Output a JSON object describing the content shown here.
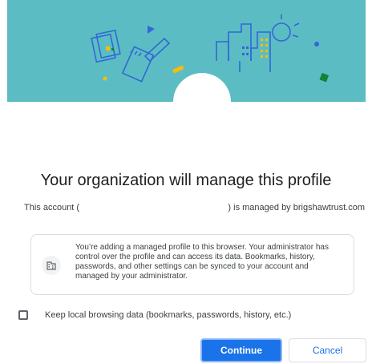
{
  "dialog": {
    "title": "Your organization will manage this profile",
    "account_prefix": "This account (",
    "account_suffix": ") is managed by brigshawtrust.com",
    "info_text": "You’re adding a managed profile to this browser. Your administrator has control over the profile and can access its data. Bookmarks, history, passwords, and other settings can be synced to your account and managed by your administrator.",
    "keep_local_label": "Keep local browsing data (bookmarks, passwords, history, etc.)",
    "keep_local_checked": false,
    "continue_label": "Continue",
    "cancel_label": "Cancel"
  },
  "icons": {
    "banner": "managed-profile-illustration",
    "info": "business-building-icon"
  },
  "colors": {
    "banner_bg": "#5bbdc3",
    "primary": "#1a73e8",
    "text": "#202124",
    "secondary_text": "#3c4043",
    "border": "#dadce0",
    "illustration_blue": "#3367d6",
    "illustration_yellow": "#fbbc04",
    "illustration_green": "#188038"
  }
}
